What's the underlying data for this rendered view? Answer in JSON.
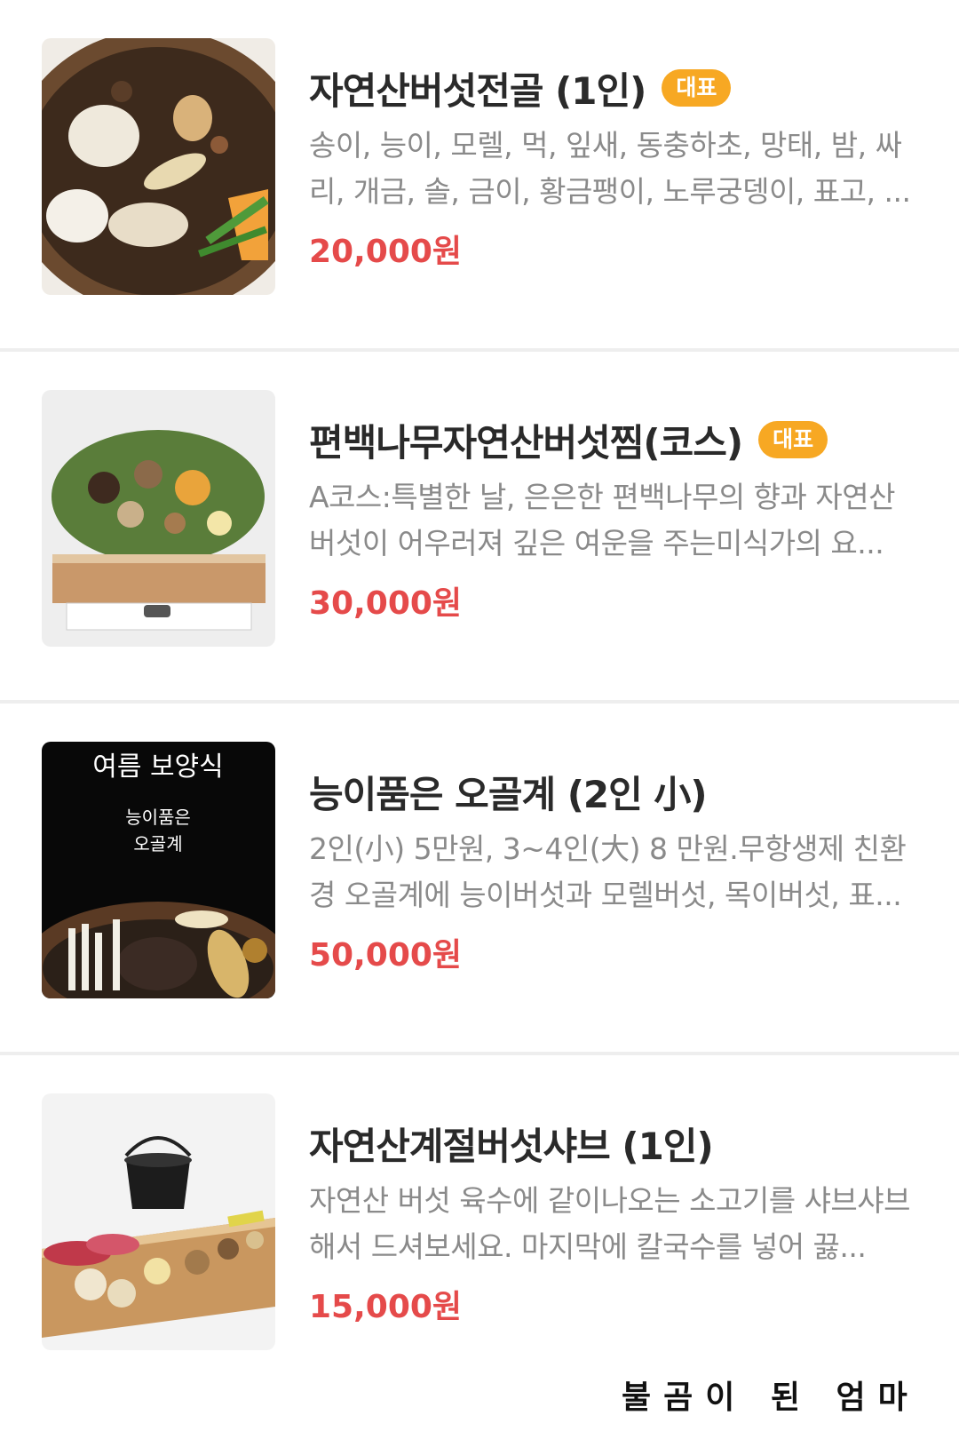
{
  "menu": {
    "items": [
      {
        "name": "자연산버섯전골 (1인)",
        "badge": "대표",
        "description": "송이, 능이, 모렐, 먹, 잎새, 동충하초, 망태, 밤, 싸리, 개금, 솔, 금이, 황금팽이, 노루궁뎅이, 표고, ...",
        "price": "20,000원"
      },
      {
        "name": "편백나무자연산버섯찜(코스)",
        "badge": "대표",
        "description": "A코스:특별한 날, 은은한 편백나무의 향과 자연산 버섯이 어우러져 깊은 여운을 주는미식가의 요...",
        "price": "30,000원"
      },
      {
        "name": "능이품은 오골계 (2인 小)",
        "badge": "",
        "description": "2인(小) 5만원, 3~4인(大) 8 만원.무항생제 친환경 오골계에 능이버섯과 모렐버섯, 목이버섯, 표...",
        "price": "50,000원",
        "image_text": [
          "여름 보양식",
          "능이품은",
          "오골계"
        ]
      },
      {
        "name": "자연산계절버섯샤브 (1인)",
        "badge": "",
        "description": "자연산 버섯 육수에 같이나오는 소고기를 샤브샤브 해서 드셔보세요. 마지막에 칼국수를 넣어 끓...",
        "price": "15,000원"
      }
    ]
  },
  "watermark": "불곰이 된 엄마",
  "colors": {
    "price": "#e54a4a",
    "badge": "#f7a823",
    "name": "#2a2a2a",
    "description": "#8a8a8a"
  }
}
